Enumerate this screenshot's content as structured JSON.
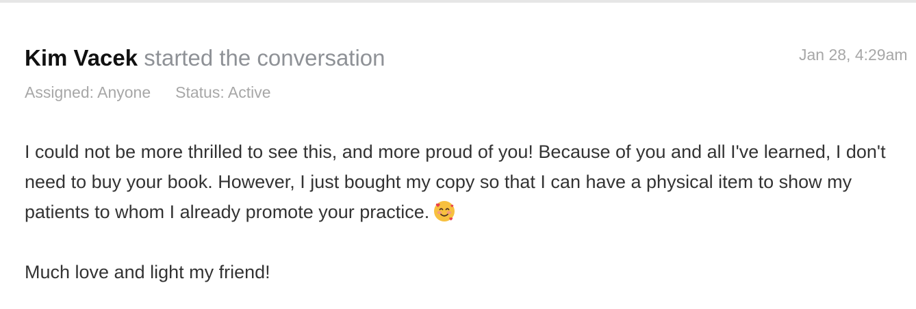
{
  "conversation": {
    "author": "Kim Vacek",
    "action": "started the conversation",
    "timestamp": "Jan 28, 4:29am",
    "assigned": "Assigned: Anyone",
    "status": "Status: Active",
    "message": {
      "paragraph1": "I could not be more thrilled to see this, and more proud of you! Because of you and all I've learned, I don't need to buy your book. However, I just bought my copy so that I can have a physical item to show my patients to whom I already promote your practice.",
      "emoji": "smiling-face-with-hearts-icon",
      "paragraph2": "Much love and light my friend!"
    }
  },
  "colors": {
    "author": "#111111",
    "action": "#8e9196",
    "meta": "#a7a7a7",
    "body": "#333333",
    "divider": "#e6e6e6"
  }
}
